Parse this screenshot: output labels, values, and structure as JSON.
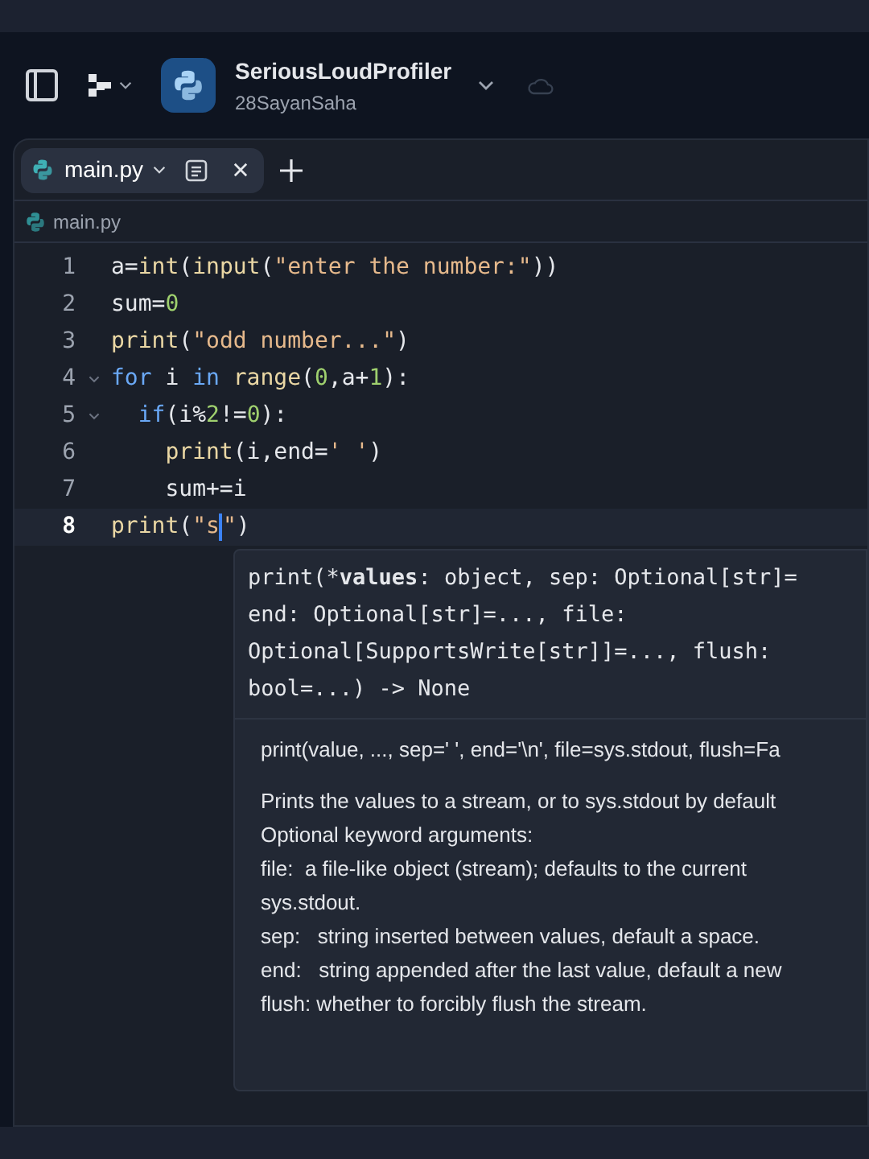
{
  "header": {
    "project": "SeriousLoudProfiler",
    "owner": "28SayanSaha"
  },
  "tabs": [
    {
      "label": "main.py",
      "selected": true
    }
  ],
  "breadcrumb": "main.py",
  "code": [
    {
      "number": "1",
      "active": false,
      "foldable": false,
      "tokens": [
        {
          "kind": "plain",
          "text": "a="
        },
        {
          "kind": "func",
          "text": "int"
        },
        {
          "kind": "plain",
          "text": "("
        },
        {
          "kind": "func",
          "text": "input"
        },
        {
          "kind": "plain",
          "text": "("
        },
        {
          "kind": "string",
          "text": "\"enter the number:\""
        },
        {
          "kind": "plain",
          "text": "))"
        }
      ]
    },
    {
      "number": "2",
      "active": false,
      "foldable": false,
      "tokens": [
        {
          "kind": "plain",
          "text": "sum="
        },
        {
          "kind": "number",
          "text": "0"
        }
      ]
    },
    {
      "number": "3",
      "active": false,
      "foldable": false,
      "tokens": [
        {
          "kind": "func",
          "text": "print"
        },
        {
          "kind": "plain",
          "text": "("
        },
        {
          "kind": "string",
          "text": "\"odd number...\""
        },
        {
          "kind": "plain",
          "text": ")"
        }
      ]
    },
    {
      "number": "4",
      "active": false,
      "foldable": true,
      "tokens": [
        {
          "kind": "keyword",
          "text": "for"
        },
        {
          "kind": "plain",
          "text": " i "
        },
        {
          "kind": "keyword",
          "text": "in"
        },
        {
          "kind": "func",
          "text": " range"
        },
        {
          "kind": "plain",
          "text": "("
        },
        {
          "kind": "number",
          "text": "0"
        },
        {
          "kind": "plain",
          "text": ",a+"
        },
        {
          "kind": "number",
          "text": "1"
        },
        {
          "kind": "plain",
          "text": "):"
        }
      ]
    },
    {
      "number": "5",
      "active": false,
      "foldable": true,
      "tokens": [
        {
          "kind": "keyword",
          "text": "  if"
        },
        {
          "kind": "plain",
          "text": "(i%"
        },
        {
          "kind": "number",
          "text": "2"
        },
        {
          "kind": "plain",
          "text": "!="
        },
        {
          "kind": "number",
          "text": "0"
        },
        {
          "kind": "plain",
          "text": "):"
        }
      ]
    },
    {
      "number": "6",
      "active": false,
      "foldable": false,
      "tokens": [
        {
          "kind": "func",
          "text": "    print"
        },
        {
          "kind": "plain",
          "text": "(i,end="
        },
        {
          "kind": "string",
          "text": "' '"
        },
        {
          "kind": "plain",
          "text": ")"
        }
      ]
    },
    {
      "number": "7",
      "active": false,
      "foldable": false,
      "tokens": [
        {
          "kind": "plain",
          "text": "    sum+=i"
        }
      ]
    },
    {
      "number": "8",
      "active": true,
      "foldable": false,
      "tokens": [
        {
          "kind": "func",
          "text": "print"
        },
        {
          "kind": "plain",
          "text": "("
        },
        {
          "kind": "string",
          "text": "\"s"
        },
        {
          "kind": "cursor"
        },
        {
          "kind": "string",
          "text": "\""
        },
        {
          "kind": "plain",
          "text": ")"
        }
      ]
    }
  ],
  "tooltip": {
    "signature": [
      [
        {
          "text": "print(*",
          "bold": false
        },
        {
          "text": "values",
          "bold": true
        },
        {
          "text": ": object, sep: Optional[str]=",
          "bold": false
        }
      ],
      "end: Optional[str]=..., file:",
      "Optional[SupportsWrite[str]]=..., flush:",
      "bool=...) -> None"
    ],
    "doc_signature": "print(value, ..., sep=' ', end='\\n', file=sys.stdout, flush=Fa",
    "doc": [
      "Prints the values to a stream, or to sys.stdout by default",
      "Optional keyword arguments:",
      "file:  a file-like object (stream); defaults to the current",
      "sys.stdout.",
      "sep:   string inserted between values, default a space.",
      "end:   string appended after the last value, default a new",
      "flush: whether to forcibly flush the stream."
    ]
  }
}
